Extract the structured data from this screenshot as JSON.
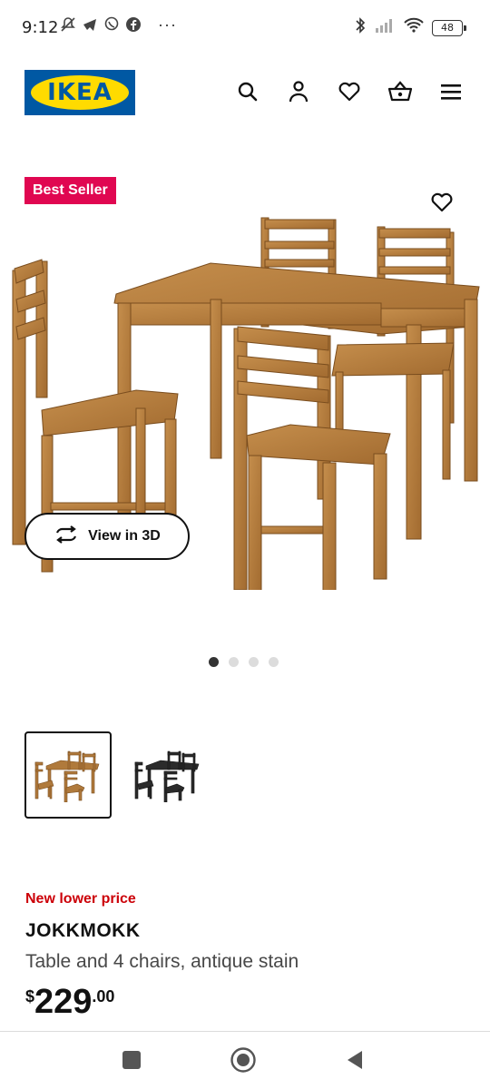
{
  "status_bar": {
    "time": "9:12",
    "overflow": "···",
    "battery": "48",
    "icons_left": [
      "mute-icon",
      "telegram-icon",
      "viber-icon",
      "facebook-icon"
    ],
    "icons_right": [
      "bluetooth-icon",
      "signal-icon",
      "wifi-icon",
      "battery-icon"
    ]
  },
  "header": {
    "logo_text": "IKEA",
    "icons": [
      "search-icon",
      "account-icon",
      "favorites-icon",
      "cart-icon",
      "menu-icon"
    ]
  },
  "product": {
    "badge": "Best Seller",
    "view_3d_label": "View in 3D",
    "image_count": 4,
    "active_image": 1,
    "promo": "New lower price",
    "name": "JOKKMOKK",
    "description": "Table and 4 chairs, antique stain",
    "price": {
      "currency": "$",
      "integer": "229",
      "decimal": ".00"
    },
    "variants": [
      {
        "color": "antique stain",
        "selected": true
      },
      {
        "color": "black-brown",
        "selected": false
      }
    ]
  },
  "colors": {
    "brand_blue": "#0058a3",
    "brand_yellow": "#ffdb00",
    "badge_red": "#e00751",
    "promo_red": "#cc0008",
    "wood": "#b07a3c"
  },
  "nav_bar": {
    "buttons": [
      "recents-button",
      "home-button",
      "back-button"
    ]
  }
}
